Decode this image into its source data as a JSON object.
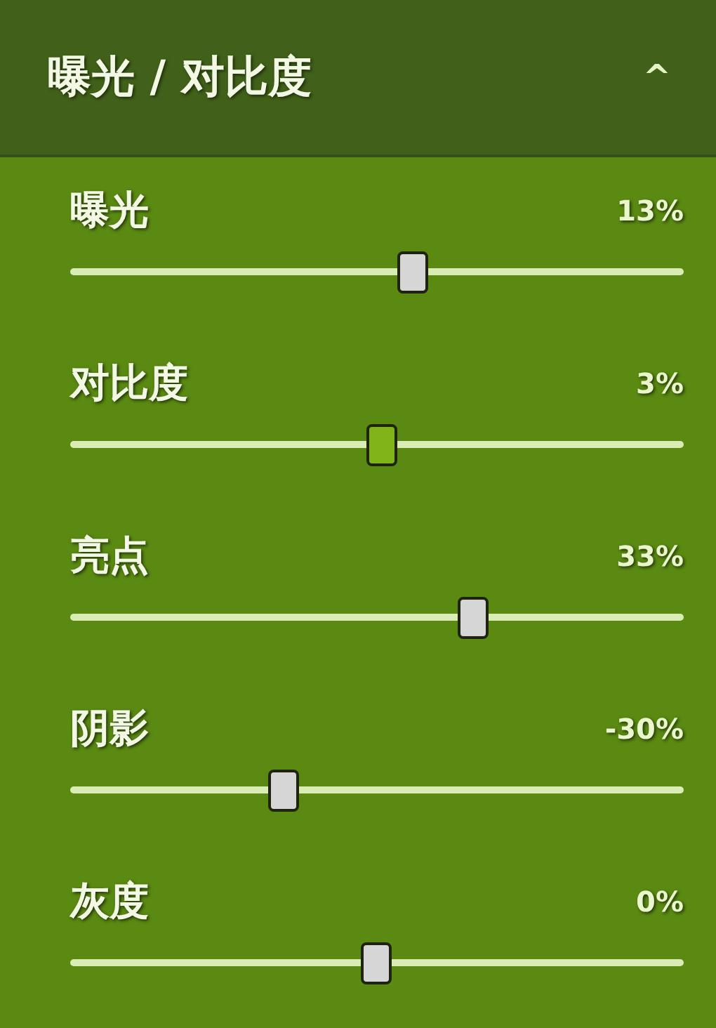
{
  "panel": {
    "title": "曝光 / 对比度",
    "collapse_icon": "^",
    "expanded": true
  },
  "sliders": [
    {
      "label": "曝光",
      "reading": "13%",
      "level": 0.56,
      "focused": false
    },
    {
      "label": "对比度",
      "reading": "3%",
      "level": 0.51,
      "focused": true
    },
    {
      "label": "亮点",
      "reading": "33%",
      "level": 0.66,
      "focused": false
    },
    {
      "label": "阴影",
      "reading": "-30%",
      "level": 0.35,
      "focused": false
    },
    {
      "label": "灰度",
      "reading": "0%",
      "level": 0.5,
      "focused": false
    }
  ]
}
